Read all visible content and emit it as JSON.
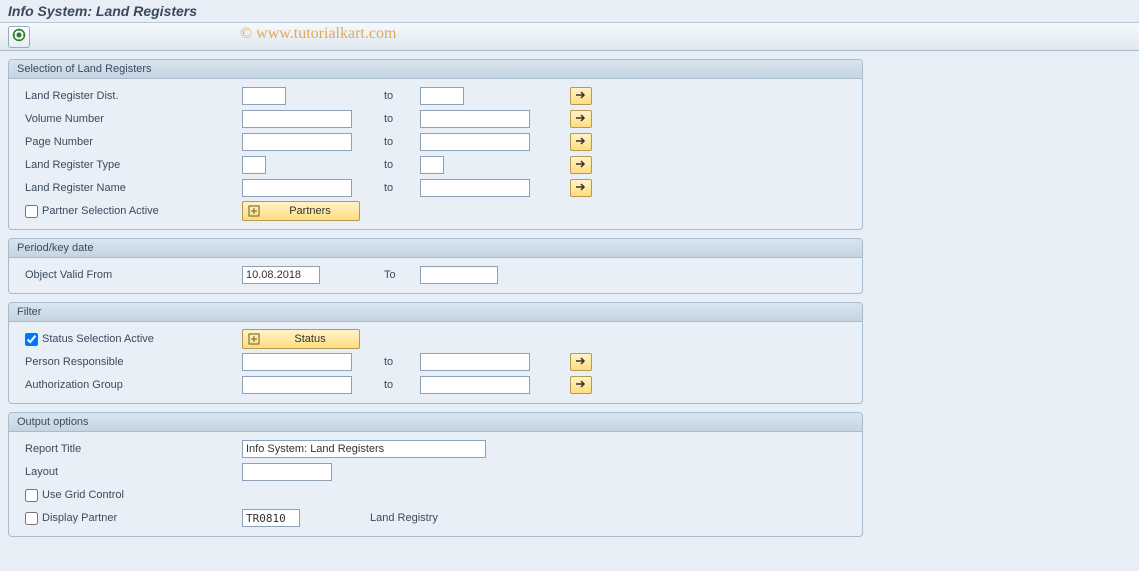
{
  "title": "Info System: Land Registers",
  "watermark": "© www.tutorialkart.com",
  "groups": {
    "selection": {
      "title": "Selection of Land Registers",
      "dist_label": "Land Register Dist.",
      "volume_label": "Volume Number",
      "page_label": "Page Number",
      "type_label": "Land Register Type",
      "name_label": "Land Register Name",
      "partner_active_label": "Partner Selection Active",
      "partners_btn": "Partners",
      "to": "to",
      "values": {
        "dist_from": "",
        "dist_to": "",
        "volume_from": "",
        "volume_to": "",
        "page_from": "",
        "page_to": "",
        "type_from": "",
        "type_to": "",
        "name_from": "",
        "name_to": "",
        "partner_active": false
      }
    },
    "period": {
      "title": "Period/key date",
      "valid_from_label": "Object Valid From",
      "to": "To",
      "values": {
        "valid_from": "10.08.2018",
        "valid_to": ""
      }
    },
    "filter": {
      "title": "Filter",
      "status_active_label": "Status Selection Active",
      "status_btn": "Status",
      "person_label": "Person Responsible",
      "auth_label": "Authorization Group",
      "to": "to",
      "values": {
        "status_active": true,
        "person_from": "",
        "person_to": "",
        "auth_from": "",
        "auth_to": ""
      }
    },
    "output": {
      "title": "Output options",
      "report_title_label": "Report Title",
      "layout_label": "Layout",
      "grid_label": "Use Grid Control",
      "display_partner_label": "Display Partner",
      "display_partner_text": "Land Registry",
      "values": {
        "report_title": "Info System: Land Registers",
        "layout": "",
        "grid": false,
        "display_partner": false,
        "display_partner_code": "TR0810"
      }
    }
  }
}
